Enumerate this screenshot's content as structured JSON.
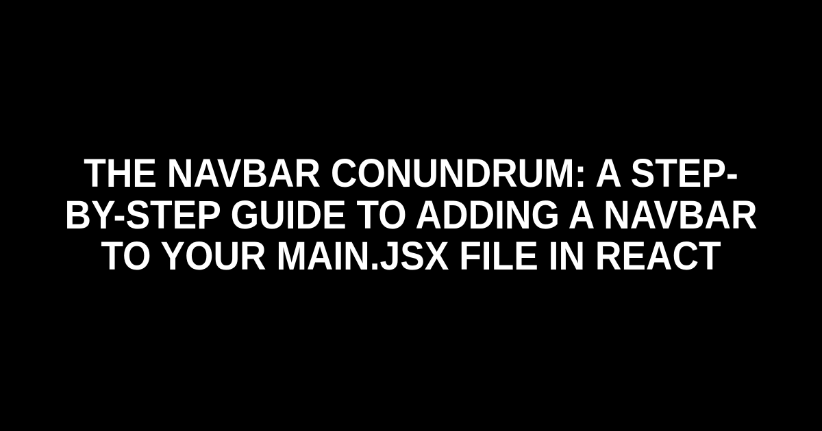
{
  "title": "THE NAVBAR CONUNDRUM: A STEP-BY-STEP GUIDE TO ADDING A NAVBAR TO YOUR MAIN.JSX FILE IN REACT"
}
